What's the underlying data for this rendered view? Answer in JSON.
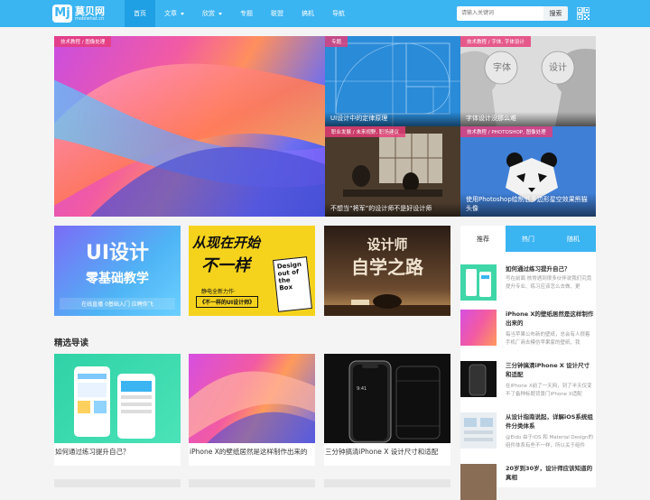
{
  "header": {
    "logo": {
      "mark": "Mj",
      "name": "莫贝网",
      "sub": "mobiwhat.cn"
    },
    "nav": [
      {
        "label": "首页",
        "active": true,
        "caret": false
      },
      {
        "label": "文章",
        "active": false,
        "caret": true
      },
      {
        "label": "欣赏",
        "active": false,
        "caret": true
      },
      {
        "label": "专题",
        "active": false,
        "caret": false
      },
      {
        "label": "联盟",
        "active": false,
        "caret": false
      },
      {
        "label": "搞机",
        "active": false,
        "caret": false
      },
      {
        "label": "导航",
        "active": false,
        "caret": false
      }
    ],
    "search": {
      "placeholder": "请输入关键词",
      "value": "",
      "button": "搜索"
    },
    "qr_icon": "qr-code-icon",
    "accent_color": "#3bb4f2"
  },
  "featured": {
    "main": {
      "tag": "技术教程 / 图像处理"
    },
    "grid": [
      {
        "tag": "专题",
        "caption": "UI设计中的定律原理"
      },
      {
        "tag": "技术教程 / 字体, 字体设计",
        "caption": "字体设计没那么难"
      },
      {
        "tag": "职业发展 / 未来视野, 职场建议",
        "caption": "不想当“将军”的设计师不是好设计师"
      },
      {
        "tag": "技术教程 / PHOTOSHOP, 图像处理",
        "caption": "使用Photoshop绘制低多边形星空效果熊猫头像"
      }
    ]
  },
  "banners": [
    {
      "line1": "UI设计",
      "line2": "零基础教学",
      "line3": "在线直播  0基础入门  应聘你飞"
    },
    {
      "line1": "从现在开始",
      "line2": "不一样",
      "line3": "静电全新力作·",
      "line4": "《不一样的UI设计师》",
      "book": "Design out of the Box"
    },
    {
      "line1": "设计师",
      "line2": "自学之路"
    }
  ],
  "section": {
    "title": "精选导读"
  },
  "cards": [
    {
      "title": "如何通过练习提升自己？"
    },
    {
      "title": "iPhone X的壁纸居然是这样制作出来的"
    },
    {
      "title": "三分钟搞清iPhone X 设计尺寸和适配"
    }
  ],
  "sidebar": {
    "tabs": [
      {
        "label": "推荐",
        "active": true
      },
      {
        "label": "热门",
        "active": false
      },
      {
        "label": "随机",
        "active": false
      }
    ],
    "items": [
      {
        "title": "如何通过练习提升自己？",
        "desc": "写在前面 核常遇到很多伙伴说我们究竟提升专业、练习应该怎么去做、更"
      },
      {
        "title": "iPhone X的壁纸居然是这样制作出来的",
        "desc": "每当苹果公布新的壁纸，总会有人很着手机厂商去模仿苹果家的壁纸，我"
      },
      {
        "title": "三分钟搞清iPhone X 设计尺寸和适配",
        "desc": "在iPhone X前了一天网，到了半天仅变不了备种标题背景门iPhone X适配"
      },
      {
        "title": "从设计指南说起，详解iOS系统组件分类体系",
        "desc": "@Eido 由于iOS 和 Material Design的组件体系有些不一样，所以关于组件"
      },
      {
        "title": "20岁到30岁，设计师应该知道的真相",
        "desc": ""
      }
    ]
  }
}
